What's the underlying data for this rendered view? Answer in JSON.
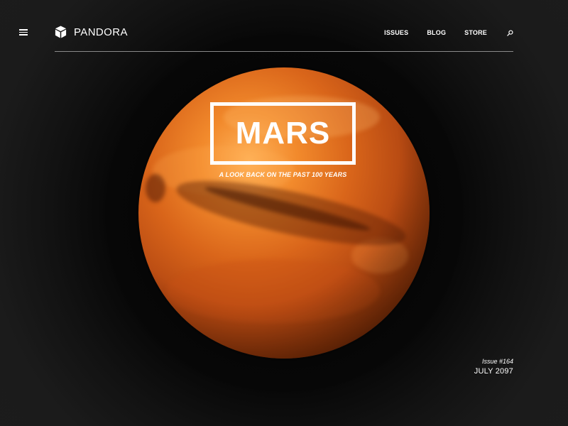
{
  "header": {
    "menu_icon": "hamburger-menu-icon",
    "brand": {
      "logo_icon": "cube-logo-icon",
      "name": "PANDORA"
    },
    "nav": {
      "items": [
        {
          "label": "ISSUES"
        },
        {
          "label": "BLOG"
        },
        {
          "label": "STORE"
        }
      ],
      "search_icon": "search-icon"
    }
  },
  "hero": {
    "title": "MARS",
    "subtitle": "A LOOK BACK ON THE PAST 100 YEARS"
  },
  "issue": {
    "number": "Issue #164",
    "date": "JULY 2097"
  },
  "colors": {
    "background": "#1b1b1b",
    "text": "#ffffff",
    "planet_primary": "#d9651a",
    "rule": "#8a8a8a"
  }
}
